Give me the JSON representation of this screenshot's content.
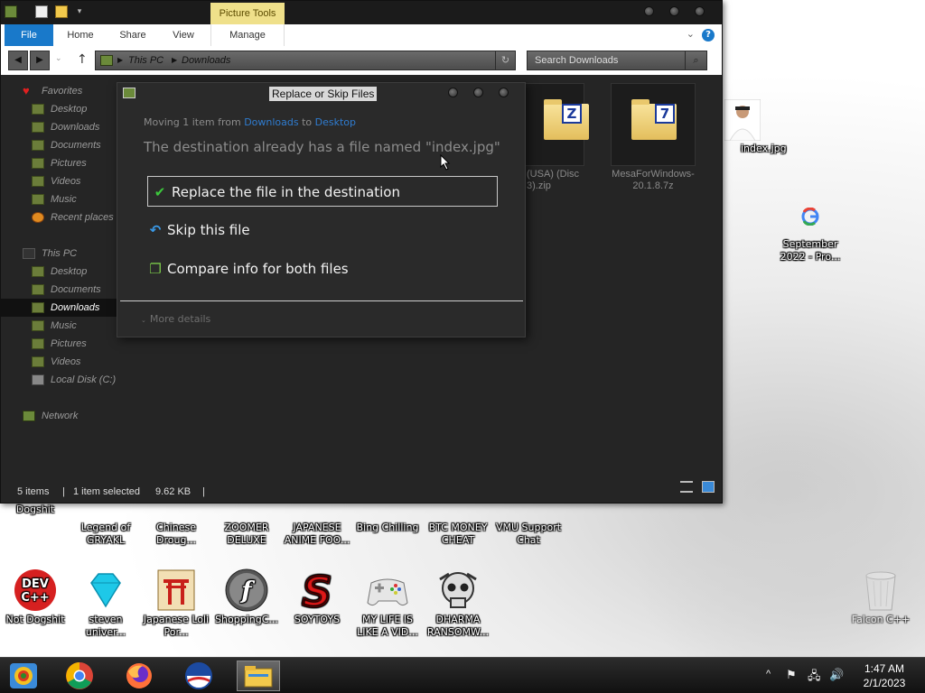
{
  "desktop": {
    "icons_row1": [
      {
        "label": "Dogshit",
        "icon": "partial-icon"
      },
      {
        "label": "Legend of GRYAKL",
        "icon": "partial-icon"
      },
      {
        "label": "Chinese Droug...",
        "icon": "partial-icon"
      },
      {
        "label": "ZOOMER DELUXE",
        "icon": "partial-icon"
      },
      {
        "label": "JAPANESE ANIME FOO...",
        "icon": "partial-icon"
      },
      {
        "label": "Bing Chilling",
        "icon": "partial-icon"
      },
      {
        "label": "BTC MONEY CHEAT",
        "icon": "partial-icon"
      },
      {
        "label": "VMU Support Chat",
        "icon": "partial-icon"
      }
    ],
    "icons_row2": [
      {
        "label": "Not Dogshit",
        "icon": "devcpp-icon"
      },
      {
        "label": "steven univer...",
        "icon": "diamond-icon"
      },
      {
        "label": "Japanese Loli Por...",
        "icon": "torii-icon"
      },
      {
        "label": "ShoppingC...",
        "icon": "flash-icon"
      },
      {
        "label": "SOYTOYS",
        "icon": "s-logo-icon"
      },
      {
        "label": "MY LIFE IS LIKE A VID...",
        "icon": "gamepad-icon"
      },
      {
        "label": "DHARMA RANSOMW...",
        "icon": "skull-icon"
      }
    ],
    "right_icons": [
      {
        "label": "index.jpg",
        "icon": "photo-icon"
      },
      {
        "label": "September 2022 - Pro...",
        "icon": "google-icon"
      },
      {
        "label": "Falcon C++",
        "icon": "recycle-bin-icon"
      }
    ]
  },
  "explorer": {
    "contextual_tab": "Picture Tools",
    "ribbon_tabs": [
      "File",
      "Home",
      "Share",
      "View",
      "Manage"
    ],
    "help": "?",
    "address": {
      "root": "This PC",
      "folder": "Downloads"
    },
    "search_placeholder": "Search Downloads",
    "nav": {
      "favorites_header": "Favorites",
      "favorites": [
        "Desktop",
        "Downloads",
        "Documents",
        "Pictures",
        "Videos",
        "Music",
        "Recent places"
      ],
      "thispc_header": "This PC",
      "thispc": [
        "Desktop",
        "Documents",
        "Downloads",
        "Music",
        "Pictures",
        "Videos",
        "Local Disk (C:)"
      ],
      "network": "Network"
    },
    "files": [
      {
        "name": "(USA) (Disc 3).zip",
        "badge": "Z"
      },
      {
        "name": "MesaForWindows-20.1.8.7z",
        "badge": "7"
      }
    ],
    "status": {
      "items": "5 items",
      "selected": "1 item selected",
      "size": "9.62 KB",
      "sep": "|"
    }
  },
  "dialog": {
    "title": "Replace or Skip Files",
    "moving_prefix": "Moving 1 item from ",
    "from": "Downloads",
    "to_word": " to ",
    "to": "Desktop",
    "destination_msg": "The destination already has a file named \"index.jpg\"",
    "options": [
      {
        "label": "Replace the file in the destination",
        "icon": "checkmark-icon"
      },
      {
        "label": "Skip this file",
        "icon": "skip-arrow-icon"
      },
      {
        "label": "Compare info for both files",
        "icon": "compare-icon"
      }
    ],
    "more_details": "More details"
  },
  "taskbar": {
    "apps": [
      "start-icon",
      "chrome-icon",
      "firefox-icon",
      "obama-logo-icon",
      "file-explorer-icon"
    ],
    "time": "1:47 AM",
    "date": "2/1/2023"
  },
  "colors": {
    "accent_blue": "#1979ca",
    "picture_tools": "#efe08a",
    "link": "#2f7cd0"
  }
}
